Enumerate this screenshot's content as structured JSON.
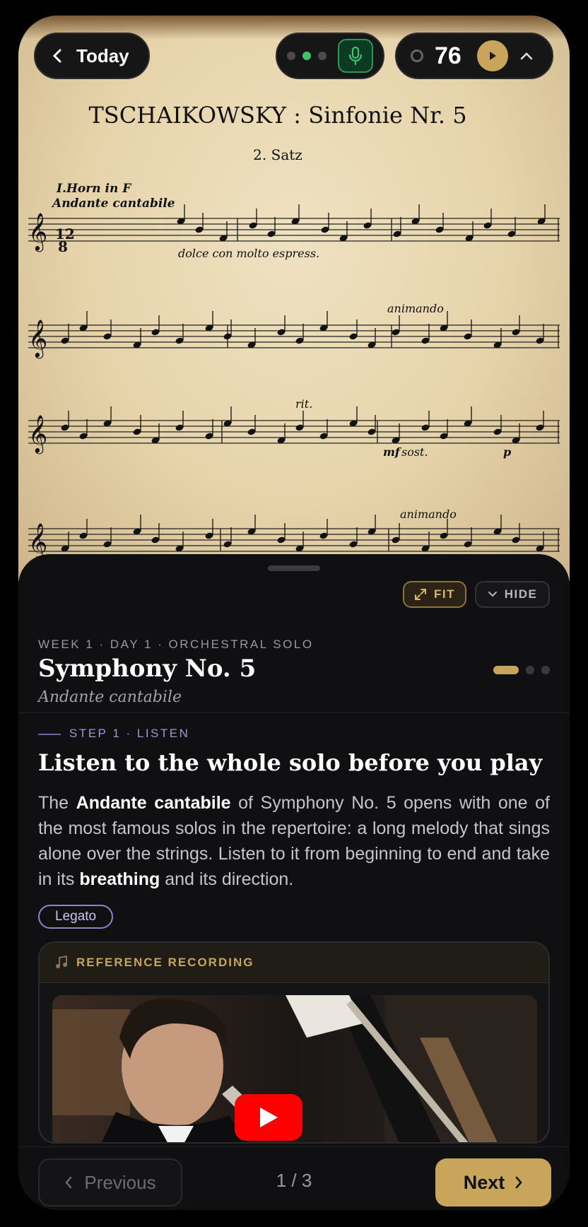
{
  "header": {
    "back_label": "Today",
    "tempo": "76"
  },
  "score": {
    "title": "TSCHAIKOWSKY : Sinfonie Nr. 5",
    "movement": "2. Satz",
    "instrument": "I.Horn in F",
    "tempo_marking": "Andante cantabile",
    "expression": "dolce con molto espress.",
    "marking_animando_1": "animando",
    "marking_rit": "rit.",
    "marking_mf": "mf",
    "marking_sost": "sost.",
    "marking_p": "p",
    "marking_animando_2": "animando"
  },
  "panel": {
    "fit_label": "FIT",
    "hide_label": "HIDE",
    "kicker": "WEEK 1 · DAY 1 · ORCHESTRAL SOLO",
    "title": "Symphony No. 5",
    "subtitle": "Andante cantabile",
    "step_label": "STEP 1 · LISTEN",
    "heading": "Listen to the whole solo before you play",
    "body": {
      "p1": "The ",
      "b1": "Andante cantabile",
      "p2": " of Symphony No. 5 opens with one of the most famous solos in the repertoire: a long melody that sings alone over the strings. Listen to it from beginning to end and take in its ",
      "b2": "breathing",
      "p3": " and its direction."
    },
    "tag": "Legato",
    "reference_label": "REFERENCE RECORDING"
  },
  "footer": {
    "previous_label": "Previous",
    "counter": "1 / 3",
    "next_label": "Next"
  },
  "colors": {
    "accent_gold": "#c9a55c",
    "mic_green": "#3ec46d",
    "step_purple": "#9b97d8",
    "youtube_red": "#ff0000"
  }
}
